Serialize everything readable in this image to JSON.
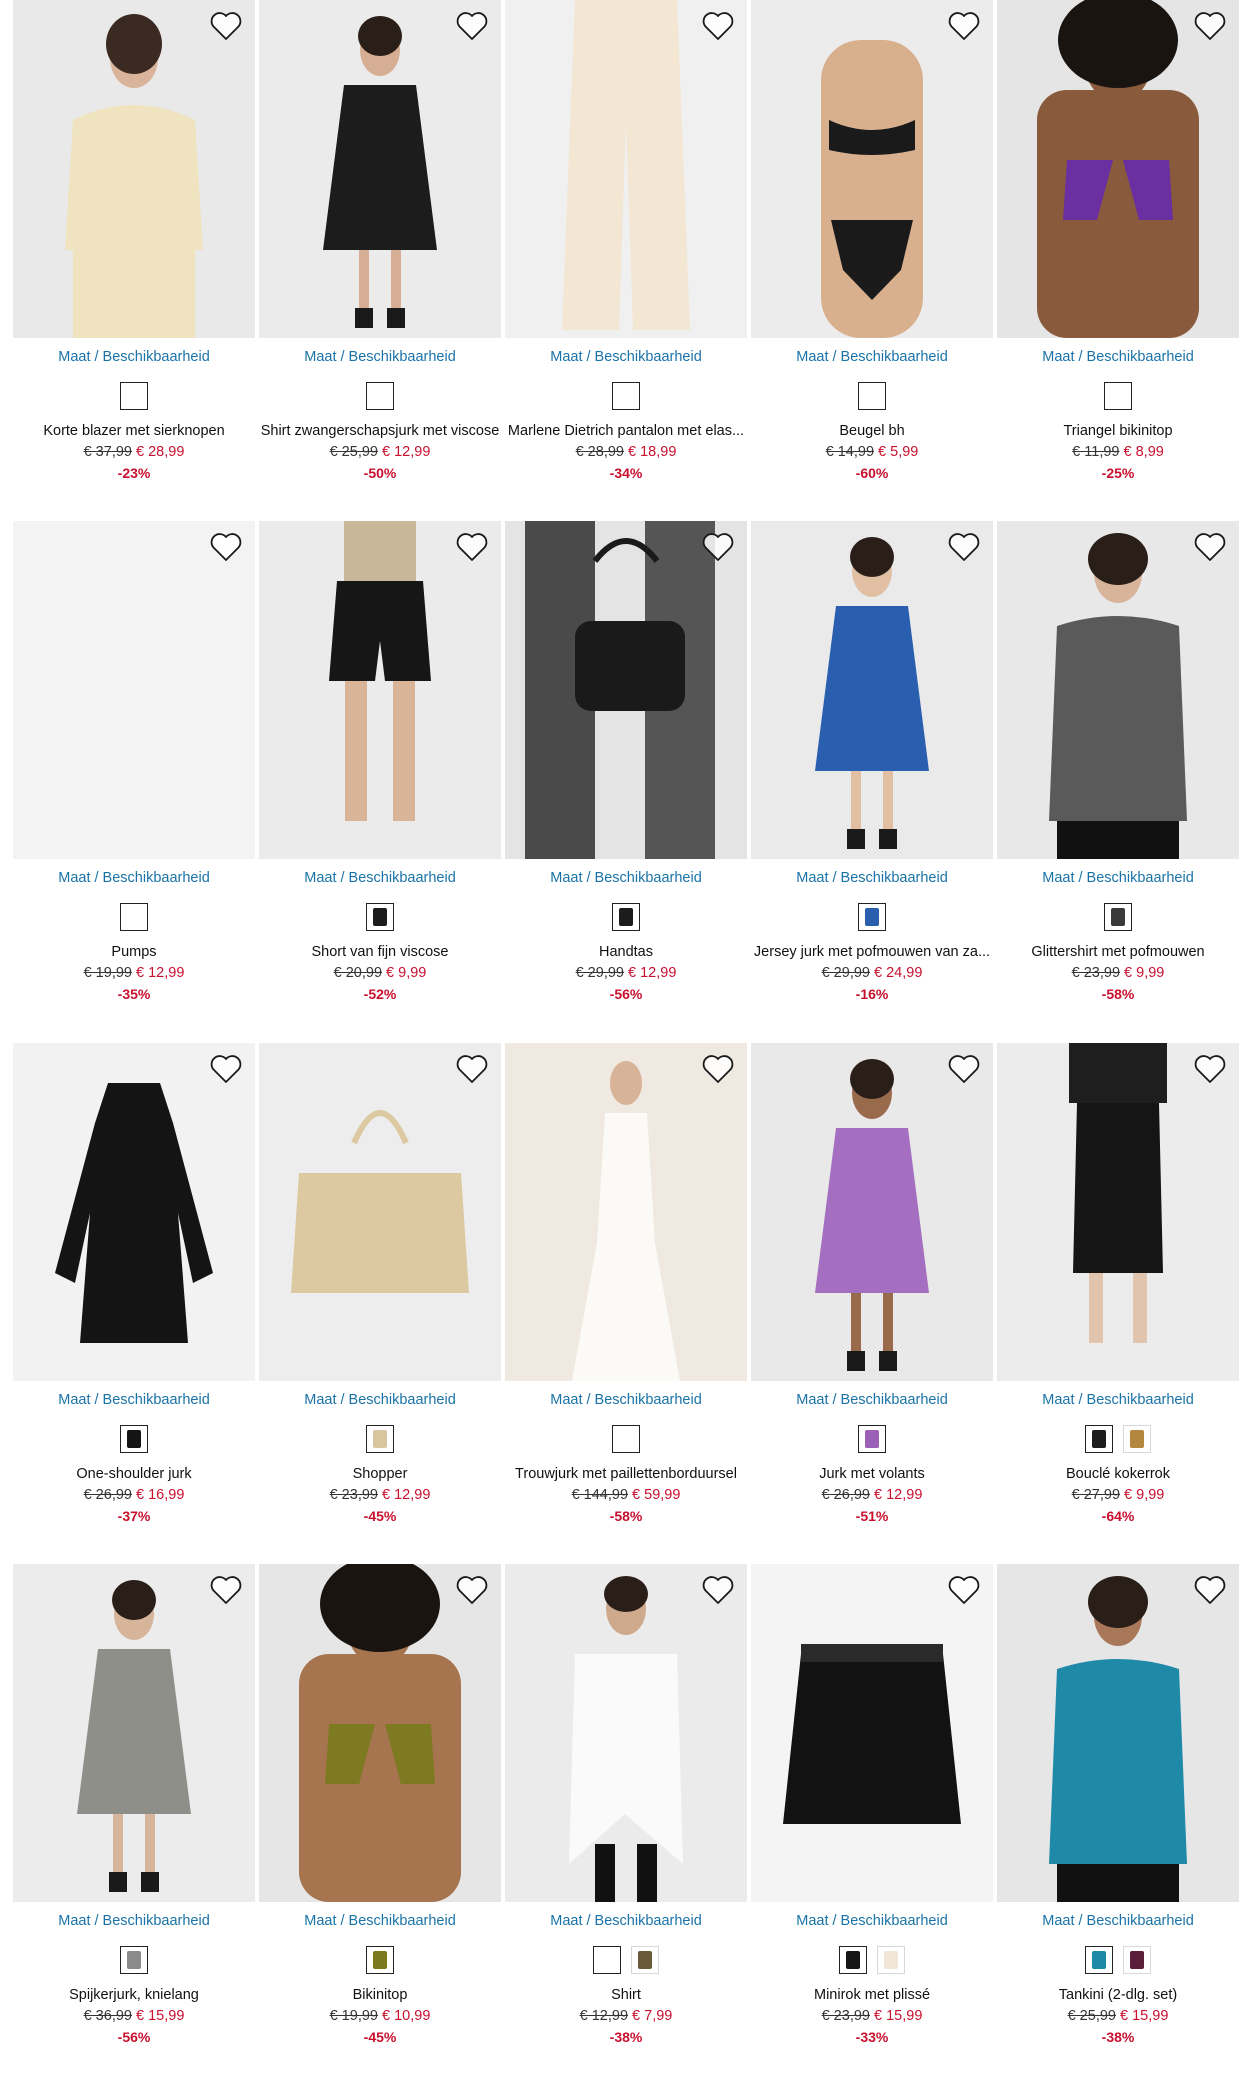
{
  "size_link_label": "Maat / Beschikbaarheid",
  "colors": {
    "link": "#1a73a8",
    "sale": "#c8102e"
  },
  "products": [
    {
      "name": "Korte blazer met sierknopen",
      "old_price": "€ 37,99",
      "new_price": "€ 28,99",
      "discount": "-23%",
      "swatches": [
        {
          "color": "#ffffff",
          "empty": true
        }
      ],
      "image": {
        "bg": "#e9e9e9",
        "garment": "#efe4bf",
        "skin": "#d9b49a",
        "type": "blazer"
      }
    },
    {
      "name": "Shirt zwangerschapsjurk met viscose",
      "old_price": "€ 25,99",
      "new_price": "€ 12,99",
      "discount": "-50%",
      "swatches": [
        {
          "color": "#ffffff",
          "empty": true
        }
      ],
      "image": {
        "bg": "#ebebeb",
        "garment": "#1c1c1c",
        "skin": "#d6ae94",
        "type": "dress"
      }
    },
    {
      "name": "Marlene Dietrich pantalon met elas...",
      "old_price": "€ 28,99",
      "new_price": "€ 18,99",
      "discount": "-34%",
      "swatches": [
        {
          "color": "#ffffff",
          "empty": true
        }
      ],
      "image": {
        "bg": "#f0f0f0",
        "garment": "#f3e6d3",
        "skin": "#e0c2a8",
        "type": "pants"
      }
    },
    {
      "name": "Beugel bh",
      "old_price": "€ 14,99",
      "new_price": "€ 5,99",
      "discount": "-60%",
      "swatches": [
        {
          "color": "#ffffff",
          "empty": true
        }
      ],
      "image": {
        "bg": "#ececec",
        "garment": "#1a1a1a",
        "skin": "#d9b08e",
        "type": "lingerie"
      }
    },
    {
      "name": "Triangel bikinitop",
      "old_price": "€ 11,99",
      "new_price": "€ 8,99",
      "discount": "-25%",
      "swatches": [
        {
          "color": "#ffffff",
          "empty": true
        }
      ],
      "image": {
        "bg": "#e5e5e5",
        "garment": "#6a2fa0",
        "skin": "#8a5a3c",
        "type": "bikini"
      }
    },
    {
      "name": "Pumps",
      "old_price": "€ 19,99",
      "new_price": "€ 12,99",
      "discount": "-35%",
      "swatches": [
        {
          "color": "#ffffff",
          "empty": true
        }
      ],
      "image": {
        "bg": "#f3f3f3",
        "garment": "#f3f3f3",
        "skin": "#f3f3f3",
        "type": "blank"
      }
    },
    {
      "name": "Short van fijn viscose",
      "old_price": "€ 20,99",
      "new_price": "€ 9,99",
      "discount": "-52%",
      "swatches": [
        {
          "color": "#1c1c1c"
        }
      ],
      "image": {
        "bg": "#ebebeb",
        "garment": "#161616",
        "skin": "#d9b497",
        "type": "shorts"
      }
    },
    {
      "name": "Handtas",
      "old_price": "€ 29,99",
      "new_price": "€ 12,99",
      "discount": "-56%",
      "swatches": [
        {
          "color": "#1c1c1c"
        }
      ],
      "image": {
        "bg": "#e4e4e4",
        "garment": "#1a1a1a",
        "skin": "#3a3a3a",
        "type": "handbag"
      }
    },
    {
      "name": "Jersey jurk met pofmouwen van za...",
      "old_price": "€ 29,99",
      "new_price": "€ 24,99",
      "discount": "-16%",
      "swatches": [
        {
          "color": "#2a5fb0"
        }
      ],
      "image": {
        "bg": "#eaeaea",
        "garment": "#2a5fb0",
        "skin": "#e0bfa3",
        "type": "dress"
      }
    },
    {
      "name": "Glittershirt met pofmouwen",
      "old_price": "€ 23,99",
      "new_price": "€ 9,99",
      "discount": "-58%",
      "swatches": [
        {
          "color": "#3a3a3a"
        }
      ],
      "image": {
        "bg": "#e8e8e8",
        "garment": "#5a5a5a",
        "skin": "#d8b49a",
        "type": "top"
      }
    },
    {
      "name": "One-shoulder jurk",
      "old_price": "€ 26,99",
      "new_price": "€ 16,99",
      "discount": "-37%",
      "swatches": [
        {
          "color": "#141414"
        }
      ],
      "image": {
        "bg": "#f2f2f2",
        "garment": "#141414",
        "skin": "#f2f2f2",
        "type": "flatdress"
      }
    },
    {
      "name": "Shopper",
      "old_price": "€ 23,99",
      "new_price": "€ 12,99",
      "discount": "-45%",
      "swatches": [
        {
          "color": "#d8c49e"
        }
      ],
      "image": {
        "bg": "#ededed",
        "garment": "#dcc9a2",
        "skin": "#ededed",
        "type": "tote"
      }
    },
    {
      "name": "Trouwjurk met paillettenborduursel",
      "old_price": "€ 144,99",
      "new_price": "€ 59,99",
      "discount": "-58%",
      "swatches": [
        {
          "color": "#ffffff",
          "empty": true
        }
      ],
      "image": {
        "bg": "#efe9e2",
        "garment": "#fbfaf6",
        "skin": "#d7b398",
        "type": "gown"
      }
    },
    {
      "name": "Jurk met volants",
      "old_price": "€ 26,99",
      "new_price": "€ 12,99",
      "discount": "-51%",
      "swatches": [
        {
          "color": "#9b5fb5"
        }
      ],
      "image": {
        "bg": "#e9e9e9",
        "garment": "#a56fc1",
        "skin": "#9a6a4c",
        "type": "dress"
      }
    },
    {
      "name": "Bouclé kokerrok",
      "old_price": "€ 27,99",
      "new_price": "€ 9,99",
      "discount": "-64%",
      "swatches": [
        {
          "color": "#1c1c1c"
        },
        {
          "color": "#b3883e",
          "alt": true
        }
      ],
      "image": {
        "bg": "#ececec",
        "garment": "#151515",
        "skin": "#e0c4ad",
        "type": "skirt"
      }
    },
    {
      "name": "Spijkerjurk, knielang",
      "old_price": "€ 36,99",
      "new_price": "€ 15,99",
      "discount": "-56%",
      "swatches": [
        {
          "color": "#8a8a8a"
        }
      ],
      "image": {
        "bg": "#ececec",
        "garment": "#8f8f8a",
        "skin": "#d6b59b",
        "type": "dress"
      }
    },
    {
      "name": "Bikinitop",
      "old_price": "€ 19,99",
      "new_price": "€ 10,99",
      "discount": "-45%",
      "swatches": [
        {
          "color": "#7a7a1e"
        }
      ],
      "image": {
        "bg": "#e6e6e6",
        "garment": "#7d7a22",
        "skin": "#a6744e",
        "type": "bikini"
      }
    },
    {
      "name": "Shirt",
      "old_price": "€ 12,99",
      "new_price": "€ 7,99",
      "discount": "-38%",
      "swatches": [
        {
          "color": "#f4f4f4",
          "empty": true
        },
        {
          "color": "#6b5a3a",
          "alt": true
        }
      ],
      "image": {
        "bg": "#ebebeb",
        "garment": "#fafafa",
        "skin": "#cfa98c",
        "type": "tunic"
      }
    },
    {
      "name": "Minirok met plissé",
      "old_price": "€ 23,99",
      "new_price": "€ 15,99",
      "discount": "-33%",
      "swatches": [
        {
          "color": "#161616"
        },
        {
          "color": "#efe6d8",
          "alt": true
        }
      ],
      "image": {
        "bg": "#f4f4f4",
        "garment": "#121212",
        "skin": "#f4f4f4",
        "type": "pleated"
      }
    },
    {
      "name": "Tankini (2-dlg. set)",
      "old_price": "€ 25,99",
      "new_price": "€ 15,99",
      "discount": "-38%",
      "swatches": [
        {
          "color": "#1e8aa8"
        },
        {
          "color": "#5a1e3a",
          "alt": true
        }
      ],
      "image": {
        "bg": "#e6e6e6",
        "garment": "#1e8aa8",
        "skin": "#a9785a",
        "type": "top"
      }
    }
  ]
}
